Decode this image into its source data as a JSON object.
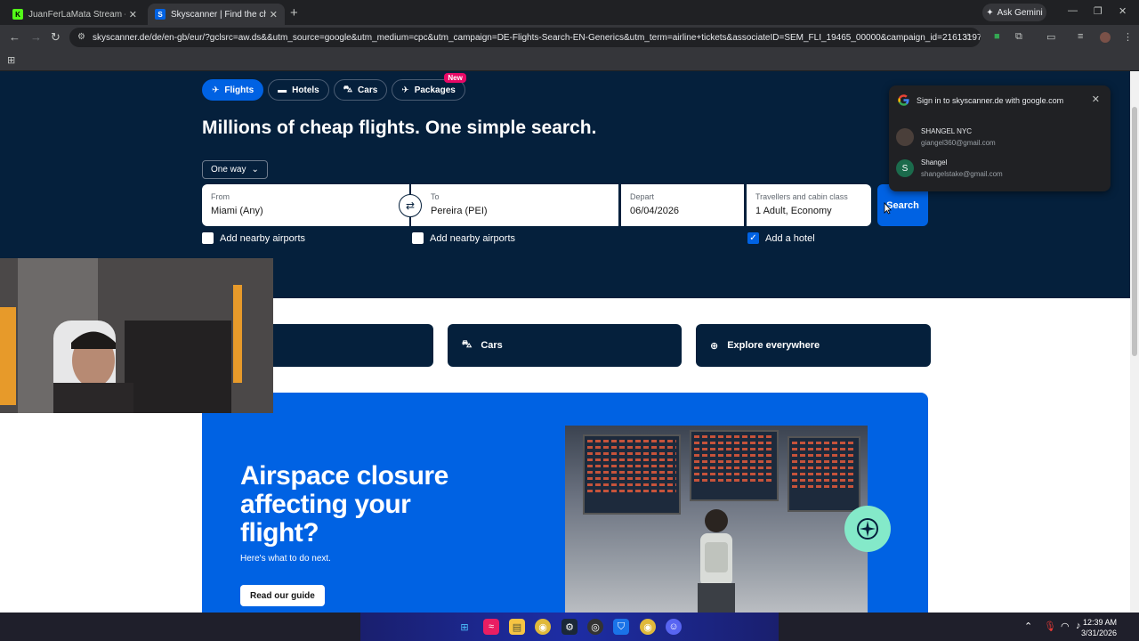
{
  "browser": {
    "tabs": [
      {
        "title": "JuanFerLaMata Stream - Watch",
        "favicon": "K"
      },
      {
        "title": "Skyscanner | Find the cheapest",
        "favicon": "S"
      }
    ],
    "new_tab": "+",
    "ask_gemini": "Ask Gemini",
    "url": "skyscanner.de/de/en-gb/eur/?gclsrc=aw.ds&&utm_source=google&utm_medium=cpc&utm_campaign=DE-Flights-Search-EN-Generics&utm_term=airline+tickets&associateID=SEM_FLI_19465_00000&campaign_id=21613197110&ad..."
  },
  "nav": {
    "tabs": [
      {
        "label": "Flights",
        "icon": "plane-icon"
      },
      {
        "label": "Hotels",
        "icon": "bed-icon"
      },
      {
        "label": "Cars",
        "icon": "car-icon"
      },
      {
        "label": "Packages",
        "icon": "package-icon",
        "badge": "New"
      }
    ]
  },
  "hero": {
    "headline": "Millions of cheap flights. One simple search.",
    "trip_type": "One way"
  },
  "search": {
    "from_label": "From",
    "from_value": "Miami (Any)",
    "to_label": "To",
    "to_value": "Pereira (PEI)",
    "depart_label": "Depart",
    "depart_value": "06/04/2026",
    "travellers_label": "Travellers and cabin class",
    "travellers_value": "1 Adult, Economy",
    "search_button": "Search",
    "nearby_from": "Add nearby airports",
    "nearby_to": "Add nearby airports",
    "add_hotel": "Add a hotel"
  },
  "quick_tiles": [
    {
      "label": "Cars",
      "icon": "car-icon"
    },
    {
      "label": "Explore everywhere",
      "icon": "explore-icon"
    }
  ],
  "promo": {
    "title": "Airspace closure affecting your flight?",
    "subtitle": "Here's what to do next.",
    "button": "Read our guide"
  },
  "google_signin": {
    "header": "Sign in to skyscanner.de with google.com",
    "accounts": [
      {
        "name": "SHANGEL NYC",
        "email": "giangel360@gmail.com",
        "initial": ""
      },
      {
        "name": "Shangel",
        "email": "shangelstake@gmail.com",
        "initial": "S"
      }
    ]
  },
  "taskbar": {
    "time": "12:39 AM",
    "date": "3/31/2026"
  },
  "colors": {
    "hero_bg": "#05203c",
    "accent": "#0062e3",
    "badge": "#e70866",
    "compass": "#84e9c9"
  }
}
